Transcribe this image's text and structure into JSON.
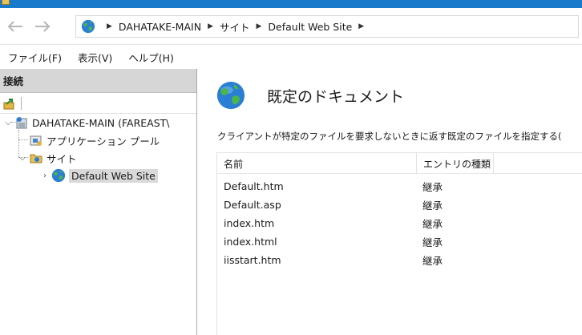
{
  "address": {
    "crumbs": [
      "DAHATAKE-MAIN",
      "サイト",
      "Default Web Site"
    ]
  },
  "menu": [
    "ファイル(F)",
    "表示(V)",
    "ヘルプ(H)"
  ],
  "left_pane": {
    "header": "接続",
    "tree": [
      {
        "label": "DAHATAKE-MAIN (FAREAST\\",
        "icon": "server-icon"
      },
      {
        "label": "アプリケーション プール",
        "icon": "app-pool-icon"
      },
      {
        "label": "サイト",
        "icon": "sites-folder-icon"
      },
      {
        "label": "Default Web Site",
        "icon": "globe-icon"
      }
    ]
  },
  "content": {
    "title": "既定のドキュメント",
    "description": "クライアントが特定のファイルを要求しないときに返す既定のファイルを指定する(",
    "columns": [
      "名前",
      "エントリの種類"
    ],
    "rows": [
      {
        "name": "Default.htm",
        "type": "継承"
      },
      {
        "name": "Default.asp",
        "type": "継承"
      },
      {
        "name": "index.htm",
        "type": "継承"
      },
      {
        "name": "index.html",
        "type": "継承"
      },
      {
        "name": "iisstart.htm",
        "type": "継承"
      }
    ]
  },
  "colors": {
    "titlebar": "#1979ca",
    "pane_header": "#d6d6d6",
    "selection": "#d9d9d9"
  }
}
